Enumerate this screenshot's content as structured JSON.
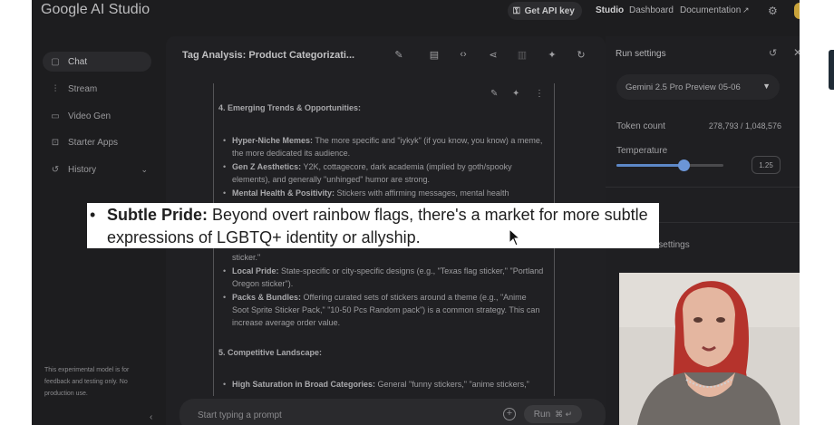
{
  "app": {
    "logo": "Google AI Studio"
  },
  "header": {
    "api_key_label": "Get API key",
    "links": [
      "Studio",
      "Dashboard",
      "Documentation"
    ]
  },
  "sidebar": {
    "items": [
      {
        "label": "Chat",
        "icon": "chat-icon"
      },
      {
        "label": "Stream",
        "icon": "stream-icon"
      },
      {
        "label": "Video Gen",
        "icon": "video-icon"
      },
      {
        "label": "Starter Apps",
        "icon": "apps-icon"
      },
      {
        "label": "History",
        "icon": "history-icon"
      }
    ],
    "note": "This experimental model is for feedback and testing only. No production use."
  },
  "chat": {
    "title": "Tag Analysis: Product Categorizati...",
    "prompt_placeholder": "Start typing a prompt",
    "run_label": "Run",
    "run_shortcut": "⌘ ↵",
    "section4_heading": "4. Emerging Trends & Opportunities:",
    "bullets_top": [
      {
        "bold": "Hyper-Niche Memes:",
        "text": " The more specific and \"iykyk\" (if you know, you know) a meme, the more dedicated its audience."
      },
      {
        "bold": "Gen Z Aesthetics:",
        "text": " Y2K, cottagecore, dark academia (implied by goth/spooky elements), and generally \"unhinged\" humor are strong."
      },
      {
        "bold": "Mental Health & Positivity:",
        "text": " Stickers with affirming messages, mental health"
      }
    ],
    "partial_line": "sticker.\"",
    "bullets_bottom": [
      {
        "bold": "Local Pride:",
        "text": " State-specific or city-specific designs (e.g., \"Texas flag sticker,\" \"Portland Oregon sticker\")."
      },
      {
        "bold": "Packs & Bundles:",
        "text": " Offering curated sets of stickers around a theme (e.g., \"Anime Soot Sprite Sticker Pack,\" \"10-50 Pcs Random pack\") is a common strategy. This can increase average order value."
      }
    ],
    "section5_heading": "5. Competitive Landscape:",
    "bullet_last": {
      "bold": "High Saturation in Broad Categories:",
      "text": " General \"funny stickers,\" \"anime stickers,\""
    }
  },
  "highlight": {
    "bold": "Subtle Pride:",
    "text": " Beyond overt rainbow flags, there's a market for more subtle expressions of LGBTQ+ identity or allyship."
  },
  "run_settings": {
    "title": "Run settings",
    "model": "Gemini 2.5 Pro Preview 05-06",
    "token_label": "Token count",
    "token_value": "278,793 / 1,048,576",
    "temperature_label": "Temperature",
    "temperature_value": "1.25",
    "temperature_fraction": 0.625,
    "advanced_label": "Advanced settings",
    "advanced_label_visible": "settings"
  },
  "colors": {
    "accent": "#6b95d6",
    "highlight_bg": "#ffffff"
  }
}
